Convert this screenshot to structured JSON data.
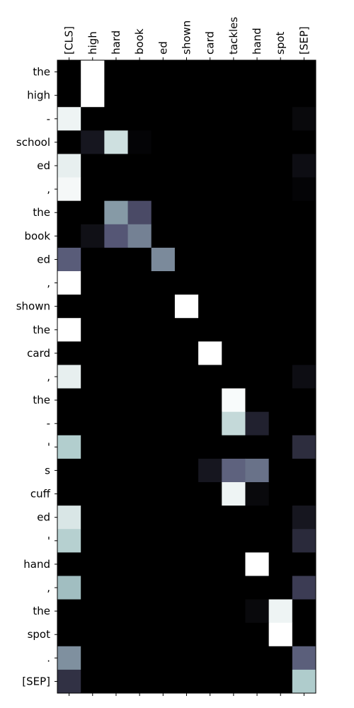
{
  "chart_data": {
    "type": "heatmap",
    "colormap": "bone",
    "x_labels": [
      "[CLS]",
      "high",
      "hard",
      "book",
      "ed",
      "shown",
      "card",
      "tackles",
      "hand",
      "spot",
      "[SEP]"
    ],
    "y_labels": [
      "the",
      "high",
      "-",
      "school",
      "ed",
      ",",
      "the",
      "book",
      "ed",
      ",",
      "shown",
      "the",
      "card",
      ",",
      "the",
      "-",
      "'",
      "s",
      "cuff",
      "ed",
      "'",
      "hand",
      ",",
      "the",
      "spot",
      ".",
      "[SEP]"
    ],
    "values": [
      [
        0.0,
        1.0,
        0.0,
        0.0,
        0.0,
        0.0,
        0.0,
        0.0,
        0.0,
        0.0,
        0.0
      ],
      [
        0.0,
        1.0,
        0.0,
        0.0,
        0.0,
        0.0,
        0.0,
        0.0,
        0.0,
        0.0,
        0.0
      ],
      [
        0.95,
        0.0,
        0.0,
        0.0,
        0.0,
        0.0,
        0.0,
        0.0,
        0.0,
        0.0,
        0.04
      ],
      [
        0.0,
        0.1,
        0.86,
        0.02,
        0.0,
        0.0,
        0.0,
        0.0,
        0.0,
        0.0,
        0.0
      ],
      [
        0.93,
        0.0,
        0.0,
        0.0,
        0.0,
        0.0,
        0.0,
        0.0,
        0.0,
        0.0,
        0.06
      ],
      [
        0.97,
        0.0,
        0.0,
        0.0,
        0.0,
        0.0,
        0.0,
        0.0,
        0.0,
        0.0,
        0.02
      ],
      [
        0.0,
        0.0,
        0.6,
        0.33,
        0.0,
        0.0,
        0.0,
        0.0,
        0.0,
        0.0,
        0.0
      ],
      [
        0.0,
        0.07,
        0.38,
        0.52,
        0.0,
        0.0,
        0.0,
        0.0,
        0.0,
        0.0,
        0.0
      ],
      [
        0.4,
        0.0,
        0.0,
        0.0,
        0.55,
        0.0,
        0.0,
        0.0,
        0.0,
        0.0,
        0.0
      ],
      [
        1.0,
        0.0,
        0.0,
        0.0,
        0.0,
        0.0,
        0.0,
        0.0,
        0.0,
        0.0,
        0.0
      ],
      [
        0.0,
        0.0,
        0.0,
        0.0,
        0.0,
        1.0,
        0.0,
        0.0,
        0.0,
        0.0,
        0.0
      ],
      [
        1.0,
        0.0,
        0.0,
        0.0,
        0.0,
        0.0,
        0.0,
        0.0,
        0.0,
        0.0,
        0.0
      ],
      [
        0.0,
        0.0,
        0.0,
        0.0,
        0.0,
        0.0,
        1.0,
        0.0,
        0.0,
        0.0,
        0.0
      ],
      [
        0.93,
        0.0,
        0.0,
        0.0,
        0.0,
        0.0,
        0.0,
        0.0,
        0.0,
        0.0,
        0.06
      ],
      [
        0.0,
        0.0,
        0.0,
        0.0,
        0.0,
        0.0,
        0.0,
        0.98,
        0.0,
        0.0,
        0.0
      ],
      [
        0.0,
        0.0,
        0.0,
        0.0,
        0.0,
        0.0,
        0.0,
        0.83,
        0.15,
        0.0,
        0.0
      ],
      [
        0.78,
        0.0,
        0.0,
        0.0,
        0.0,
        0.0,
        0.0,
        0.0,
        0.0,
        0.0,
        0.2
      ],
      [
        0.0,
        0.0,
        0.0,
        0.0,
        0.0,
        0.0,
        0.1,
        0.42,
        0.47,
        0.0,
        0.0
      ],
      [
        0.0,
        0.0,
        0.0,
        0.0,
        0.0,
        0.0,
        0.0,
        0.95,
        0.04,
        0.0,
        0.0
      ],
      [
        0.89,
        0.0,
        0.0,
        0.0,
        0.0,
        0.0,
        0.0,
        0.0,
        0.0,
        0.0,
        0.1
      ],
      [
        0.79,
        0.0,
        0.0,
        0.0,
        0.0,
        0.0,
        0.0,
        0.0,
        0.0,
        0.0,
        0.19
      ],
      [
        0.0,
        0.0,
        0.0,
        0.0,
        0.0,
        0.0,
        0.0,
        0.0,
        1.0,
        0.0,
        0.0
      ],
      [
        0.72,
        0.0,
        0.0,
        0.0,
        0.0,
        0.0,
        0.0,
        0.0,
        0.0,
        0.0,
        0.27
      ],
      [
        0.0,
        0.0,
        0.0,
        0.0,
        0.0,
        0.0,
        0.0,
        0.0,
        0.04,
        0.95,
        0.0
      ],
      [
        0.0,
        0.0,
        0.0,
        0.0,
        0.0,
        0.0,
        0.0,
        0.0,
        0.0,
        1.0,
        0.0
      ],
      [
        0.57,
        0.0,
        0.0,
        0.0,
        0.0,
        0.0,
        0.0,
        0.0,
        0.0,
        0.0,
        0.41
      ],
      [
        0.22,
        0.0,
        0.0,
        0.0,
        0.0,
        0.0,
        0.0,
        0.0,
        0.0,
        0.0,
        0.77
      ]
    ],
    "vmin": 0,
    "vmax": 1,
    "grid": false,
    "legend": "none",
    "title": "",
    "xlabel": "",
    "ylabel": ""
  }
}
